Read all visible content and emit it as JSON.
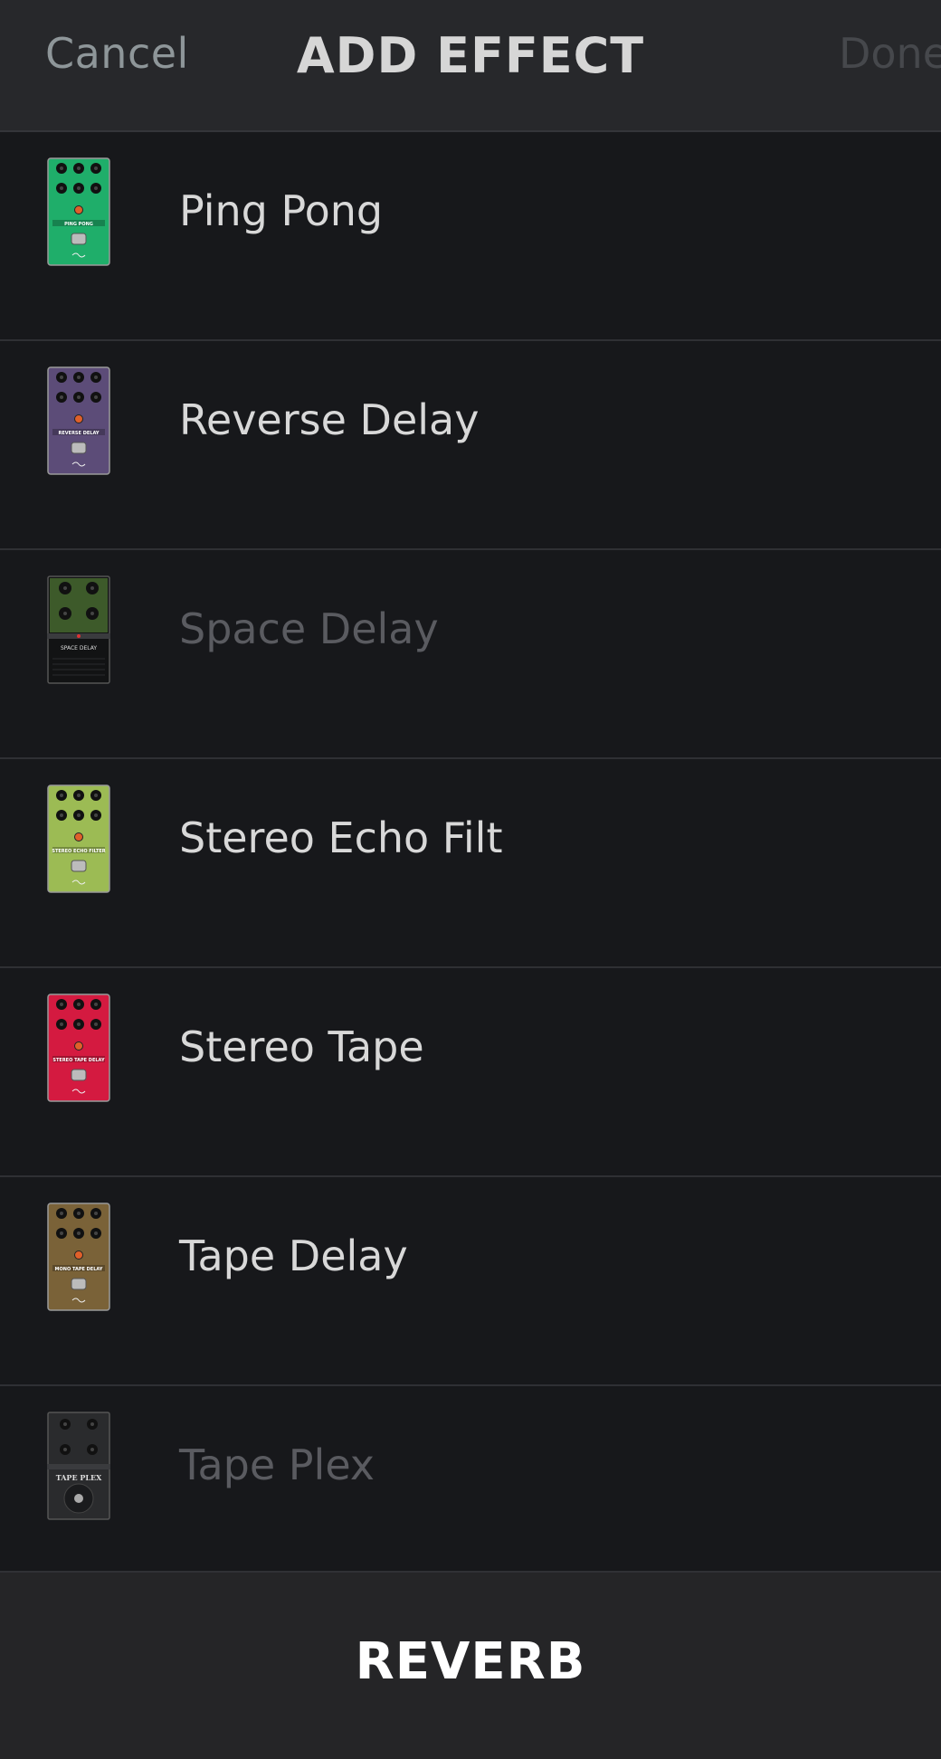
{
  "header": {
    "cancel_label": "Cancel",
    "title": "ADD EFFECT",
    "done_label": "Done"
  },
  "effects": [
    {
      "name": "Ping Pong",
      "pedal_text": "PING PONG",
      "color": "#1fae6a",
      "style": "standard",
      "enabled": true
    },
    {
      "name": "Reverse Delay",
      "pedal_text": "REVERSE DELAY",
      "color": "#5c4c78",
      "style": "standard",
      "enabled": true
    },
    {
      "name": "Space Delay",
      "pedal_text": "SPACE DELAY",
      "color": "#3d5a2a",
      "style": "dark",
      "enabled": false
    },
    {
      "name": "Stereo Echo Filt",
      "pedal_text": "STEREO ECHO FILTER",
      "color": "#9cbb54",
      "style": "standard",
      "enabled": true
    },
    {
      "name": "Stereo Tape",
      "pedal_text": "STEREO TAPE DELAY",
      "color": "#d41a40",
      "style": "standard",
      "enabled": true
    },
    {
      "name": "Tape Delay",
      "pedal_text": "MONO TAPE DELAY",
      "color": "#7a6238",
      "style": "standard",
      "enabled": true
    },
    {
      "name": "Tape Plex",
      "pedal_text": "TAPE PLEX",
      "color": "#2a2b2d",
      "style": "plex",
      "enabled": false
    }
  ],
  "footer": {
    "category_label": "REVERB"
  }
}
